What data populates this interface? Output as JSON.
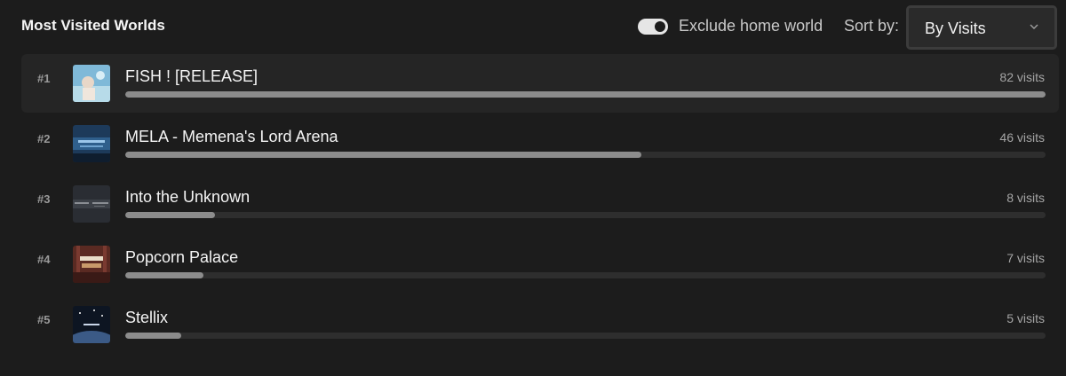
{
  "header": {
    "title": "Most Visited Worlds",
    "exclude_toggle_label": "Exclude home world",
    "exclude_toggle_on": true,
    "sort_label": "Sort by:",
    "sort_value": "By Visits"
  },
  "worlds": [
    {
      "rank": "#1",
      "name": "FISH ! [RELEASE]",
      "visits": "82 visits",
      "count": 82,
      "thumb_icon": "fish-world-thumbnail",
      "thumb_colors": [
        "#7fb9d8",
        "#e8d7c8"
      ]
    },
    {
      "rank": "#2",
      "name": "MELA - Memena's Lord Arena",
      "visits": "46 visits",
      "count": 46,
      "thumb_icon": "mela-world-thumbnail",
      "thumb_colors": [
        "#1d3a5a",
        "#4d8fc2"
      ]
    },
    {
      "rank": "#3",
      "name": "Into the Unknown",
      "visits": "8 visits",
      "count": 8,
      "thumb_icon": "unknown-world-thumbnail",
      "thumb_colors": [
        "#2a2d33",
        "#55585e"
      ]
    },
    {
      "rank": "#4",
      "name": "Popcorn Palace",
      "visits": "7 visits",
      "count": 7,
      "thumb_icon": "popcorn-world-thumbnail",
      "thumb_colors": [
        "#5a2a22",
        "#c89a6a"
      ]
    },
    {
      "rank": "#5",
      "name": "Stellix",
      "visits": "5 visits",
      "count": 5,
      "thumb_icon": "stellix-world-thumbnail",
      "thumb_colors": [
        "#0d1522",
        "#3b5a86"
      ]
    }
  ],
  "max_visits": 82,
  "colors": {
    "background": "#1c1c1c",
    "bar_fill": "#8c8c8c",
    "bar_track": "#2e2e2e",
    "row_highlight": "#252525"
  }
}
